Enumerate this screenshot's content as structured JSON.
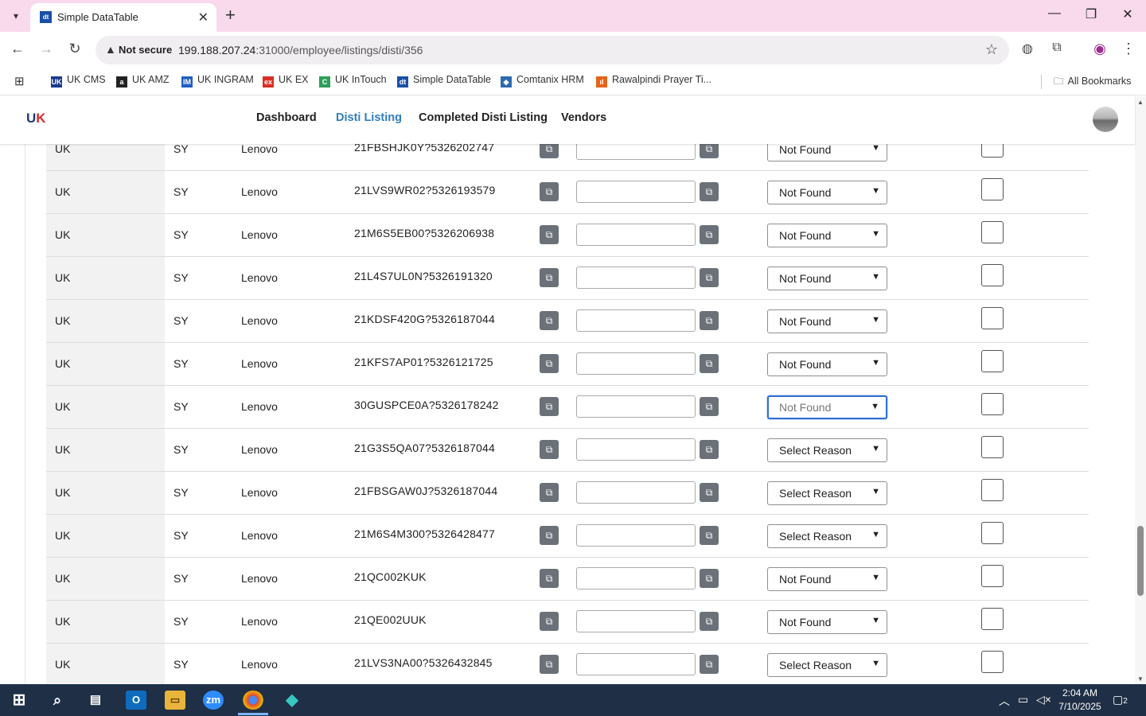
{
  "browser": {
    "tab_title": "Simple DataTable",
    "tab_favicon": "dt",
    "not_secure_label": "Not secure",
    "url_host": "199.188.207.24",
    "url_rest": ":31000/employee/listings/disti/356",
    "bookmarks": [
      {
        "label": "UK CMS",
        "icon": "uk-cms-icon",
        "color": "#1a3a8f",
        "glyph": "UK"
      },
      {
        "label": "UK AMZ",
        "icon": "amazon-icon",
        "color": "#222222",
        "glyph": "a"
      },
      {
        "label": "UK INGRAM",
        "icon": "ingram-icon",
        "color": "#1f5fbf",
        "glyph": "IM"
      },
      {
        "label": "UK EX",
        "icon": "ex-icon",
        "color": "#d93025",
        "glyph": "ex"
      },
      {
        "label": "UK InTouch",
        "icon": "intouch-icon",
        "color": "#2e9e5b",
        "glyph": "C"
      },
      {
        "label": "Simple DataTable",
        "icon": "datatable-icon",
        "color": "#1a4fa8",
        "glyph": "dt"
      },
      {
        "label": "Comtanix HRM",
        "icon": "comtanix-icon",
        "color": "#2b6cb0",
        "glyph": "◆"
      },
      {
        "label": "Rawalpindi Prayer Ti...",
        "icon": "prayer-icon",
        "color": "#e3641a",
        "glyph": "ıl"
      }
    ],
    "all_bookmarks_label": "All Bookmarks"
  },
  "app": {
    "logo_text_1": "U",
    "logo_text_2": "K",
    "menu": [
      {
        "label": "Dashboard",
        "active": false
      },
      {
        "label": "Disti Listing",
        "active": true
      },
      {
        "label": "Completed Disti Listing",
        "active": false
      },
      {
        "label": "Vendors",
        "active": false
      }
    ],
    "accent_color": "#2f7fc1"
  },
  "table": {
    "rows": [
      {
        "country": "UK",
        "dist": "SY",
        "brand": "Lenovo",
        "code": "21FBSHJK0Y?5326202747",
        "reason": "Not Found",
        "focused": false
      },
      {
        "country": "UK",
        "dist": "SY",
        "brand": "Lenovo",
        "code": "21LVS9WR02?5326193579",
        "reason": "Not Found",
        "focused": false
      },
      {
        "country": "UK",
        "dist": "SY",
        "brand": "Lenovo",
        "code": "21M6S5EB00?5326206938",
        "reason": "Not Found",
        "focused": false
      },
      {
        "country": "UK",
        "dist": "SY",
        "brand": "Lenovo",
        "code": "21L4S7UL0N?5326191320",
        "reason": "Not Found",
        "focused": false
      },
      {
        "country": "UK",
        "dist": "SY",
        "brand": "Lenovo",
        "code": "21KDSF420G?5326187044",
        "reason": "Not Found",
        "focused": false
      },
      {
        "country": "UK",
        "dist": "SY",
        "brand": "Lenovo",
        "code": "21KFS7AP01?5326121725",
        "reason": "Not Found",
        "focused": false
      },
      {
        "country": "UK",
        "dist": "SY",
        "brand": "Lenovo",
        "code": "30GUSPCE0A?5326178242",
        "reason": "Not Found",
        "focused": true
      },
      {
        "country": "UK",
        "dist": "SY",
        "brand": "Lenovo",
        "code": "21G3S5QA07?5326187044",
        "reason": "Select Reason",
        "focused": false
      },
      {
        "country": "UK",
        "dist": "SY",
        "brand": "Lenovo",
        "code": "21FBSGAW0J?5326187044",
        "reason": "Select Reason",
        "focused": false
      },
      {
        "country": "UK",
        "dist": "SY",
        "brand": "Lenovo",
        "code": "21M6S4M300?5326428477",
        "reason": "Select Reason",
        "focused": false
      },
      {
        "country": "UK",
        "dist": "SY",
        "brand": "Lenovo",
        "code": "21QC002KUK",
        "reason": "Not Found",
        "focused": false
      },
      {
        "country": "UK",
        "dist": "SY",
        "brand": "Lenovo",
        "code": "21QE002UUK",
        "reason": "Not Found",
        "focused": false
      },
      {
        "country": "UK",
        "dist": "SY",
        "brand": "Lenovo",
        "code": "21LVS3NA00?5326432845",
        "reason": "Select Reason",
        "focused": false
      }
    ]
  },
  "taskbar": {
    "time": "2:04 AM",
    "date": "7/10/2025",
    "notifications": "2"
  }
}
